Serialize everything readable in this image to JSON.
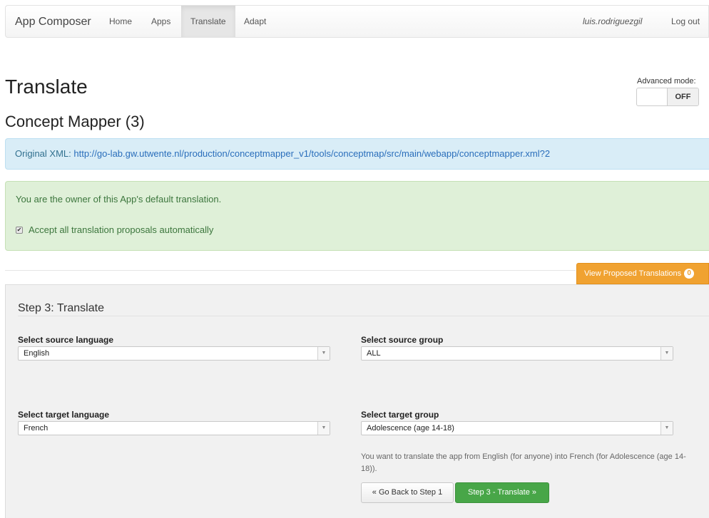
{
  "navbar": {
    "brand": "App Composer",
    "items": [
      {
        "label": "Home"
      },
      {
        "label": "Apps"
      },
      {
        "label": "Translate"
      },
      {
        "label": "Adapt"
      }
    ],
    "user": "luis.rodriguezgil",
    "logout": "Log out"
  },
  "page": {
    "title": "Translate",
    "app_title": "Concept Mapper (3)"
  },
  "advanced_mode": {
    "label": "Advanced mode:",
    "state": "OFF"
  },
  "original_xml": {
    "label": "Original XML:",
    "url": "http://go-lab.gw.utwente.nl/production/conceptmapper_v1/tools/conceptmap/src/main/webapp/conceptmapper.xml?2"
  },
  "ownership": {
    "message": "You are the owner of this App's default translation.",
    "accept_label": "Accept all translation proposals automatically",
    "accept_checked": true
  },
  "proposed": {
    "label": "View Proposed Translations",
    "count": "0"
  },
  "step": {
    "title": "Step 3: Translate",
    "source_language_label": "Select source language",
    "source_language_value": "English",
    "source_group_label": "Select source group",
    "source_group_value": "ALL",
    "target_language_label": "Select target language",
    "target_language_value": "French",
    "target_group_label": "Select target group",
    "target_group_value": "Adolescence (age 14-18)",
    "summary": "You want to translate the app from English (for anyone) into French (for Adolescence (age 14-18)).",
    "back_button": "« Go Back to Step 1",
    "next_button": "Step 3 - Translate »"
  },
  "colors": {
    "info_bg": "#d9edf7",
    "success_bg": "#dff0d8",
    "warning_button": "#f0a231",
    "success_button": "#48a648"
  }
}
